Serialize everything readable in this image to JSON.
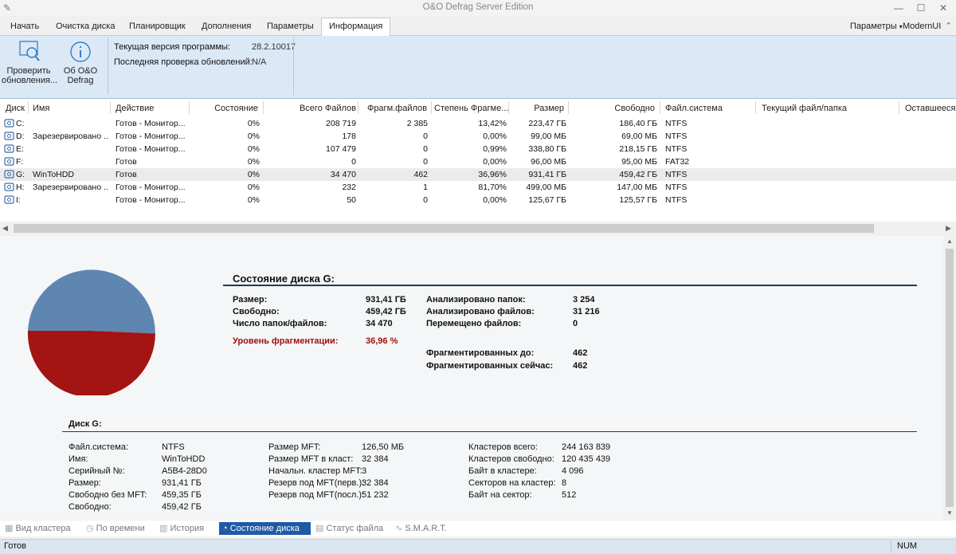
{
  "window": {
    "title": "O&O Defrag Server Edition"
  },
  "tabs": [
    "Начать",
    "Очистка диска",
    "Планировщик",
    "Дополнения",
    "Параметры",
    "Информация"
  ],
  "active_tab": "Информация",
  "right_menu": {
    "params": "Параметры",
    "theme": "ModernUI"
  },
  "ribbon": {
    "check_updates": [
      "Проверить",
      "обновления..."
    ],
    "about": [
      "Об O&O",
      "Defrag"
    ],
    "version_label": "Текущая версия программы:",
    "version_value": "28.2.10017",
    "last_check_label": "Последняя проверка обновлений:",
    "last_check_value": "N/A"
  },
  "table": {
    "columns": [
      "Диск",
      "Имя",
      "Действие",
      "Состояние",
      "Всего Файлов",
      "Фрагм.файлов",
      "Степень Фрагме...",
      "Размер",
      "Свободно",
      "Файл.система",
      "Текущий файл/папка",
      "Оставшееся в"
    ],
    "rows": [
      [
        "C:",
        "",
        "Готов - Монитор...",
        "0%",
        "208 719",
        "2 385",
        "13,42%",
        "223,47 ГБ",
        "186,40 ГБ",
        "NTFS"
      ],
      [
        "D:",
        "Зарезервировано ...",
        "Готов - Монитор...",
        "0%",
        "178",
        "0",
        "0,00%",
        "99,00 МБ",
        "69,00 МБ",
        "NTFS"
      ],
      [
        "E:",
        "",
        "Готов - Монитор...",
        "0%",
        "107 479",
        "0",
        "0,99%",
        "338,80 ГБ",
        "218,15 ГБ",
        "NTFS"
      ],
      [
        "F:",
        "",
        "Готов",
        "0%",
        "0",
        "0",
        "0,00%",
        "96,00 МБ",
        "95,00 МБ",
        "FAT32"
      ],
      [
        "G:",
        "WinToHDD",
        "Готов",
        "0%",
        "34 470",
        "462",
        "36,96%",
        "931,41 ГБ",
        "459,42 ГБ",
        "NTFS"
      ],
      [
        "H:",
        "Зарезервировано ...",
        "Готов - Монитор...",
        "0%",
        "232",
        "1",
        "81,70%",
        "499,00 МБ",
        "147,00 МБ",
        "NTFS"
      ],
      [
        "I:",
        "",
        "Готов - Монитор...",
        "0%",
        "50",
        "0",
        "0,00%",
        "125,67 ГБ",
        "125,57 ГБ",
        "NTFS"
      ]
    ],
    "selected_row": 4
  },
  "disk_state": {
    "heading": "Состояние диска G:",
    "left": [
      [
        "Размер:",
        "931,41 ГБ"
      ],
      [
        "Свободно:",
        "459,42 ГБ"
      ],
      [
        "Число папок/файлов:",
        "34 470"
      ]
    ],
    "frag_label": "Уровень фрагментации:",
    "frag_value": "36,96 %",
    "right": [
      [
        "Анализировано папок:",
        "3 254"
      ],
      [
        "Анализировано файлов:",
        "31 216"
      ],
      [
        "Перемещено файлов:",
        "0"
      ]
    ],
    "right2": [
      [
        "Фрагментированных до:",
        "462"
      ],
      [
        "Фрагментированных сейчас:",
        "462"
      ]
    ],
    "pie": {
      "used_fraction": 0.5068,
      "colors": {
        "used": "#a31412",
        "free": "#5f86b1"
      }
    }
  },
  "disk_details": {
    "heading": "Диск G:",
    "col1": [
      [
        "Файл.система:",
        "NTFS"
      ],
      [
        "Имя:",
        "WinToHDD"
      ],
      [
        "Серийный №:",
        "A5B4-28D0"
      ],
      [
        "Размер:",
        "931,41 ГБ"
      ],
      [
        "Свободно без MFT:",
        "459,35 ГБ"
      ],
      [
        "Свободно:",
        "459,42 ГБ"
      ]
    ],
    "col2": [
      [
        "Размер MFT:",
        "126,50 МБ"
      ],
      [
        "Размер MFT в класт:",
        "32 384"
      ],
      [
        "Начальн. кластер MFT:",
        "3"
      ],
      [
        "Резерв под MFT(перв.):",
        "32 384"
      ],
      [
        "Резерв под MFT(посл.):",
        "51 232"
      ]
    ],
    "col3": [
      [
        "Кластеров всего:",
        "244 163 839"
      ],
      [
        "Кластеров свободно:",
        "120 435 439"
      ],
      [
        "Байт в кластере:",
        "4 096"
      ],
      [
        "Секторов на кластер:",
        "8"
      ],
      [
        "Байт на сектор:",
        "512"
      ]
    ]
  },
  "bottom_tabs": [
    "Вид кластера",
    "По времени",
    "История",
    "Состояние диска",
    "Статус файла",
    "S.M.A.R.T."
  ],
  "bottom_active": "Состояние диска",
  "status": {
    "left": "Готов",
    "num": "NUM"
  },
  "colors": {
    "accent": "#1f5aa6",
    "ribbon": "#dbe8f6",
    "heading_line": "#1d3b5c"
  }
}
